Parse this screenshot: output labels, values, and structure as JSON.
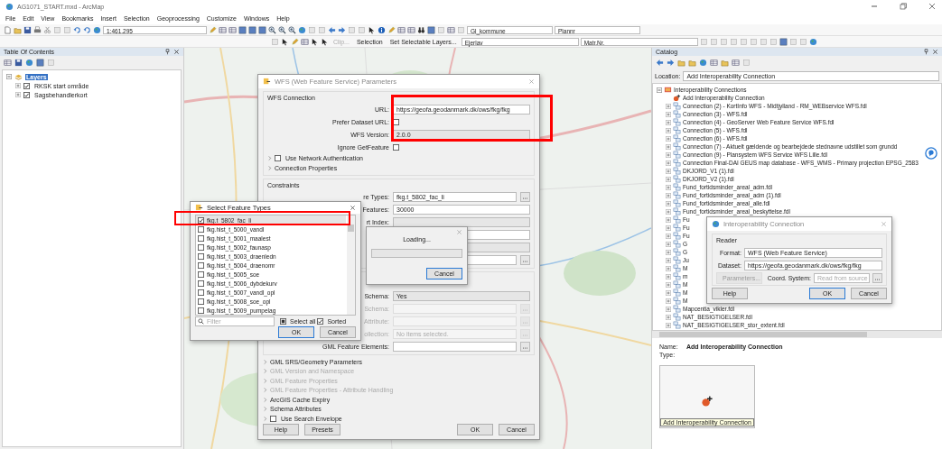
{
  "window": {
    "title": "AG1071_START.mxd - ArcMap"
  },
  "menu": [
    "File",
    "Edit",
    "View",
    "Bookmarks",
    "Insert",
    "Selection",
    "Geoprocessing",
    "Customize",
    "Windows",
    "Help"
  ],
  "toolbar": {
    "scale": "1:461.295",
    "layer_dropdown": "Gl_kommune",
    "plan_dropdown": "Plannr",
    "clip": "Clip...",
    "selection": "Selection",
    "selectable_layers": "Set Selectable Layers...",
    "ejerlav_dropdown": "Ejerlav",
    "matr_dropdown": "Matr.Nr."
  },
  "toc": {
    "title": "Table Of Contents",
    "root": {
      "label": "Layers",
      "selected": true,
      "expanded": true,
      "children": [
        {
          "label": "RKSK start område",
          "checked": true
        },
        {
          "label": "Sagsbehandlerkort",
          "checked": true
        }
      ]
    }
  },
  "wfs_dialog": {
    "title": "WFS (Web Feature Service) Parameters",
    "connection": {
      "header": "WFS Connection",
      "url_label": "URL:",
      "url": "https://geofa.geodanmark.dk/ows/fkg/fkg",
      "prefer_label": "Prefer Dataset URL:",
      "prefer_checked": false,
      "version_label": "WFS Version:",
      "version": "2.0.0",
      "ignore_label": "Ignore GetFeature",
      "ignore_checked": false,
      "auth_label": "Use Network Authentication",
      "auth_checked": false,
      "properties": "Connection Properties"
    },
    "constraints": {
      "header": "Constraints",
      "rows": [
        {
          "kind": "input",
          "label": "re Types:",
          "value": "fkg.t_5802_fac_li",
          "browse": true
        },
        {
          "kind": "input",
          "label": "Features:",
          "value": "30000",
          "browse": false
        },
        {
          "kind": "select",
          "label": "rt Index:",
          "value": "",
          "browse": false
        },
        {
          "kind": "input",
          "label": "",
          "value": "",
          "browse": false
        },
        {
          "kind": "select",
          "label": "",
          "value": "",
          "browse": false
        },
        {
          "kind": "input",
          "label": "",
          "value": "",
          "browse": true
        }
      ]
    },
    "schema_rows": [
      {
        "kind": "select",
        "label": "Schema:",
        "value": "Yes",
        "disabled": false
      },
      {
        "kind": "input",
        "label": "Schema:",
        "value": "",
        "disabled": true
      },
      {
        "kind": "input",
        "label": "Attribute:",
        "value": "",
        "disabled": true
      },
      {
        "kind": "input",
        "label": "ollection:",
        "placeholder": "No items selected.",
        "disabled": true
      },
      {
        "kind": "input",
        "label": "GML Feature Elements:",
        "value": "",
        "disabled": false
      }
    ],
    "sections": [
      {
        "kind": "section",
        "label": "GML SRS/Geometry Parameters",
        "disabled": false
      },
      {
        "kind": "section",
        "label": "GML Version and Namespace",
        "disabled": true
      },
      {
        "kind": "section",
        "label": "GML Feature Properties",
        "disabled": true
      },
      {
        "kind": "section",
        "label": "GML Feature Properties - Attribute Handling",
        "disabled": true
      },
      {
        "kind": "section",
        "label": "ArcGIS Cache Expiry",
        "disabled": false
      },
      {
        "kind": "section",
        "label": "Schema Attributes",
        "disabled": false
      },
      {
        "kind": "checkbox",
        "label": "Use Search Envelope",
        "checked": false
      }
    ],
    "buttons": {
      "help": "Help",
      "presets": "Presets",
      "ok": "OK",
      "cancel": "Cancel"
    }
  },
  "select_dialog": {
    "title": "Select Feature Types",
    "items": [
      {
        "label": "fkg.t_5802_fac_li",
        "checked": true,
        "selected": true
      },
      {
        "label": "fkg.hist_t_5000_vandl",
        "checked": false,
        "selected": false
      },
      {
        "label": "fkg.hist_t_5001_maalest",
        "checked": false,
        "selected": false
      },
      {
        "label": "fkg.hist_t_5002_faunasp",
        "checked": false,
        "selected": false
      },
      {
        "label": "fkg.hist_t_5003_draenledn",
        "checked": false,
        "selected": false
      },
      {
        "label": "fkg.hist_t_5004_draenomr",
        "checked": false,
        "selected": false
      },
      {
        "label": "fkg.hist_t_5005_soe",
        "checked": false,
        "selected": false
      },
      {
        "label": "fkg.hist_t_5006_dybdekurv",
        "checked": false,
        "selected": false
      },
      {
        "label": "fkg.hist_t_5007_vandl_opl",
        "checked": false,
        "selected": false
      },
      {
        "label": "fkg.hist_t_5008_soe_opl",
        "checked": false,
        "selected": false
      },
      {
        "label": "fkg.hist_t_5009_pumpelag",
        "checked": false,
        "selected": false
      }
    ],
    "filter_placeholder": "Filter",
    "select_all": "Select all",
    "select_all_partial": true,
    "sorted": "Sorted",
    "sorted_checked": true,
    "ok": "OK",
    "cancel": "Cancel"
  },
  "loading_dialog": {
    "message": "Loading...",
    "level": 0,
    "cancel": "Cancel"
  },
  "highlights": [
    {
      "kind": "frame"
    },
    {
      "kind": "frame"
    }
  ],
  "catalog": {
    "title": "Catalog",
    "location_label": "Location:",
    "location": "Add Interoperability Connection",
    "tree": {
      "label": "Interoperability Connections",
      "expanded": true,
      "children": [
        {
          "kind": "add",
          "label": "Add Interoperability Connection"
        },
        {
          "kind": "connection",
          "label": "Connection (2) - KortInfo WFS - Midtjylland - RM_WEBservice WFS.fdl"
        },
        {
          "kind": "connection",
          "label": "Connection (3) -  WFS.fdl"
        },
        {
          "kind": "connection",
          "label": "Connection (4) - GeoServer Web Feature Service WFS.fdl"
        },
        {
          "kind": "connection",
          "label": "Connection (5) -  WFS.fdl"
        },
        {
          "kind": "connection",
          "label": "Connection (6) -  WFS.fdl"
        },
        {
          "kind": "connection",
          "label": "Connection (7) - Aktuelt gældende og bearbejdede stednavne udstillet som grundd"
        },
        {
          "kind": "connection",
          "label": "Connection (9) - Plansystem WFS Service WFS Lille.fdl"
        },
        {
          "kind": "connection",
          "label": "Connection Final-DAI GEUS map database - WFS_WMS - Primary projection EPSG_2583"
        },
        {
          "kind": "connection",
          "label": "DKJORD_V1 (1).fdl"
        },
        {
          "kind": "connection",
          "label": "DKJORD_V2 (1).fdl"
        },
        {
          "kind": "connection",
          "label": "Fund_fortidsminder_areal_adm.fdl"
        },
        {
          "kind": "connection",
          "label": "Fund_fortidsminder_areal_adm (1).fdl"
        },
        {
          "kind": "connection",
          "label": "Fund_fortidsminder_areal_alle.fdl"
        },
        {
          "kind": "connection",
          "label": "Fund_fortidsminder_areal_beskyttelse.fdl"
        },
        {
          "kind": "connection",
          "label": "Fu"
        },
        {
          "kind": "connection",
          "label": "Fu"
        },
        {
          "kind": "connection",
          "label": "Fu"
        },
        {
          "kind": "connection",
          "label": "G"
        },
        {
          "kind": "connection",
          "label": "G"
        },
        {
          "kind": "connection",
          "label": "Ju"
        },
        {
          "kind": "connection",
          "label": "M"
        },
        {
          "kind": "connection",
          "label": "m"
        },
        {
          "kind": "connection",
          "label": "M"
        },
        {
          "kind": "connection",
          "label": "M"
        },
        {
          "kind": "connection",
          "label": "M"
        },
        {
          "kind": "connection",
          "label": "Mapcentia_vikler.fdl"
        },
        {
          "kind": "connection",
          "label": "NAT_BESIGTIGELSER.fdl"
        },
        {
          "kind": "connection",
          "label": "NAT_BESIGTIGELSER_stor_extent.fdl"
        }
      ]
    },
    "name_label": "Name:",
    "name": "Add Interoperability Connection",
    "type_label": "Type:",
    "thumbnail_caption": "Add Interoperability Connection"
  },
  "interop_dialog": {
    "title": "Interoperability Connection",
    "group": "Reader",
    "format_label": "Format:",
    "format": "WFS (Web Feature Service)",
    "dataset_label": "Dataset:",
    "dataset": "https://geofa.geodanmark.dk/ows/fkg/fkg",
    "parameters": "Parameters...",
    "coord_label": "Coord. System:",
    "coord_placeholder": "Read from source",
    "help": "Help",
    "ok": "OK",
    "cancel": "Cancel"
  }
}
